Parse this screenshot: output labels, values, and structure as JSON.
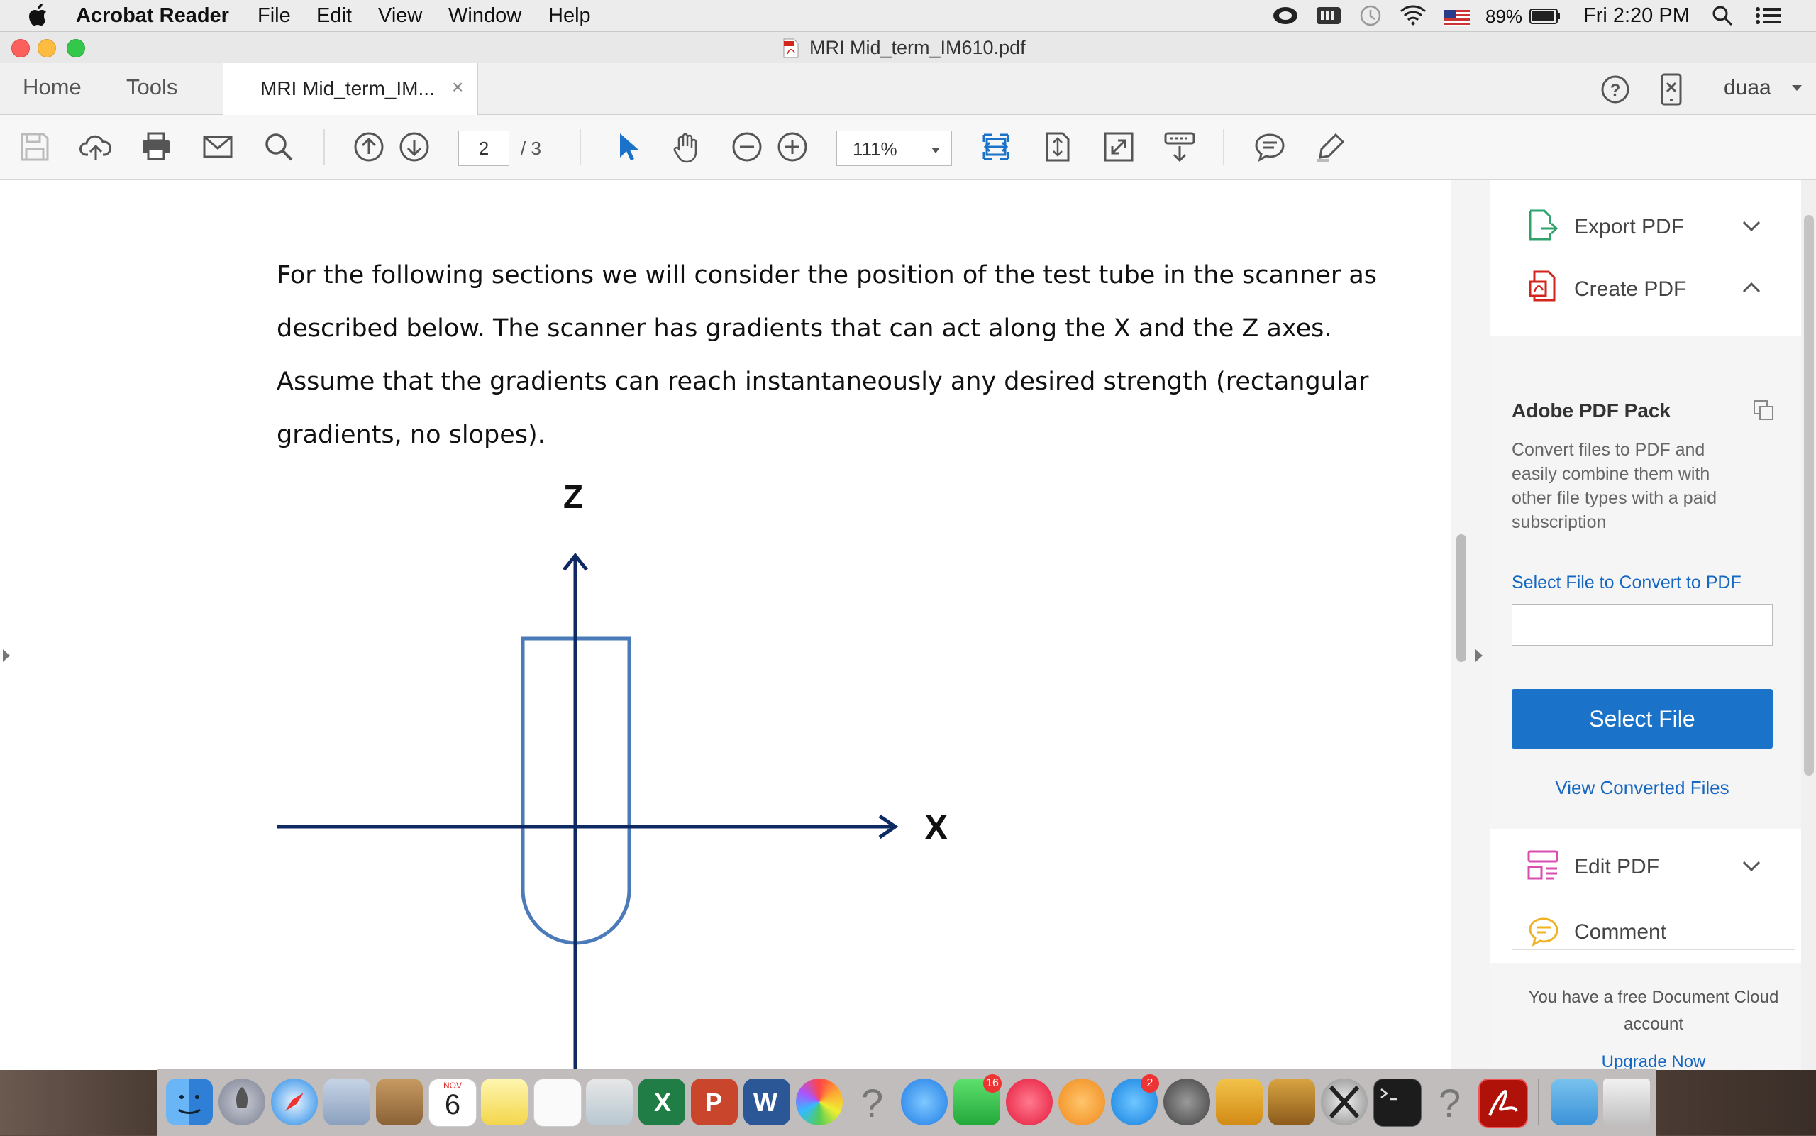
{
  "menubar": {
    "apple": "",
    "app_name": "Acrobat Reader",
    "menus": [
      "File",
      "Edit",
      "View",
      "Window",
      "Help"
    ],
    "battery": "89%",
    "clock": "Fri 2:20 PM"
  },
  "window": {
    "title": "MRI Mid_term_IM610.pdf"
  },
  "tabs": {
    "home": "Home",
    "tools": "Tools",
    "document": "MRI Mid_term_IM...",
    "close": "×",
    "user": "duaa"
  },
  "toolbar": {
    "page_current": "2",
    "page_total": "/ 3",
    "zoom": "111%"
  },
  "document": {
    "lines": [
      "For the following sections we will consider the position of the test tube in the scanner as",
      "described below. The scanner has gradients that can act along the X and the Z axes.",
      "Assume that the gradients can reach instantaneously any desired strength (rectangular",
      "gradients, no slopes)."
    ],
    "axis_z": "Z",
    "axis_x": "X"
  },
  "panel": {
    "export_pdf": "Export PDF",
    "create_pdf": "Create PDF",
    "pack_title": "Adobe PDF Pack",
    "pack_desc": "Convert files to PDF and easily combine them with other file types with a paid subscription",
    "select_convert_label": "Select File to Convert to PDF",
    "file_input_value": "",
    "select_file_button": "Select File",
    "view_converted": "View Converted Files",
    "edit_pdf": "Edit PDF",
    "comment": "Comment",
    "cloud_note": "You have a free Document Cloud account",
    "upgrade": "Upgrade Now"
  },
  "dock": {
    "calendar_month": "NOV",
    "calendar_day": "6",
    "facetime_badge": "16",
    "appstore_badge": "2"
  },
  "colors": {
    "accent_blue": "#1a73c9",
    "link_blue": "#1667c2",
    "axis_navy": "#0d2a63",
    "tube_blue": "#4a7ab8",
    "acrobat_red": "#d2261c"
  }
}
